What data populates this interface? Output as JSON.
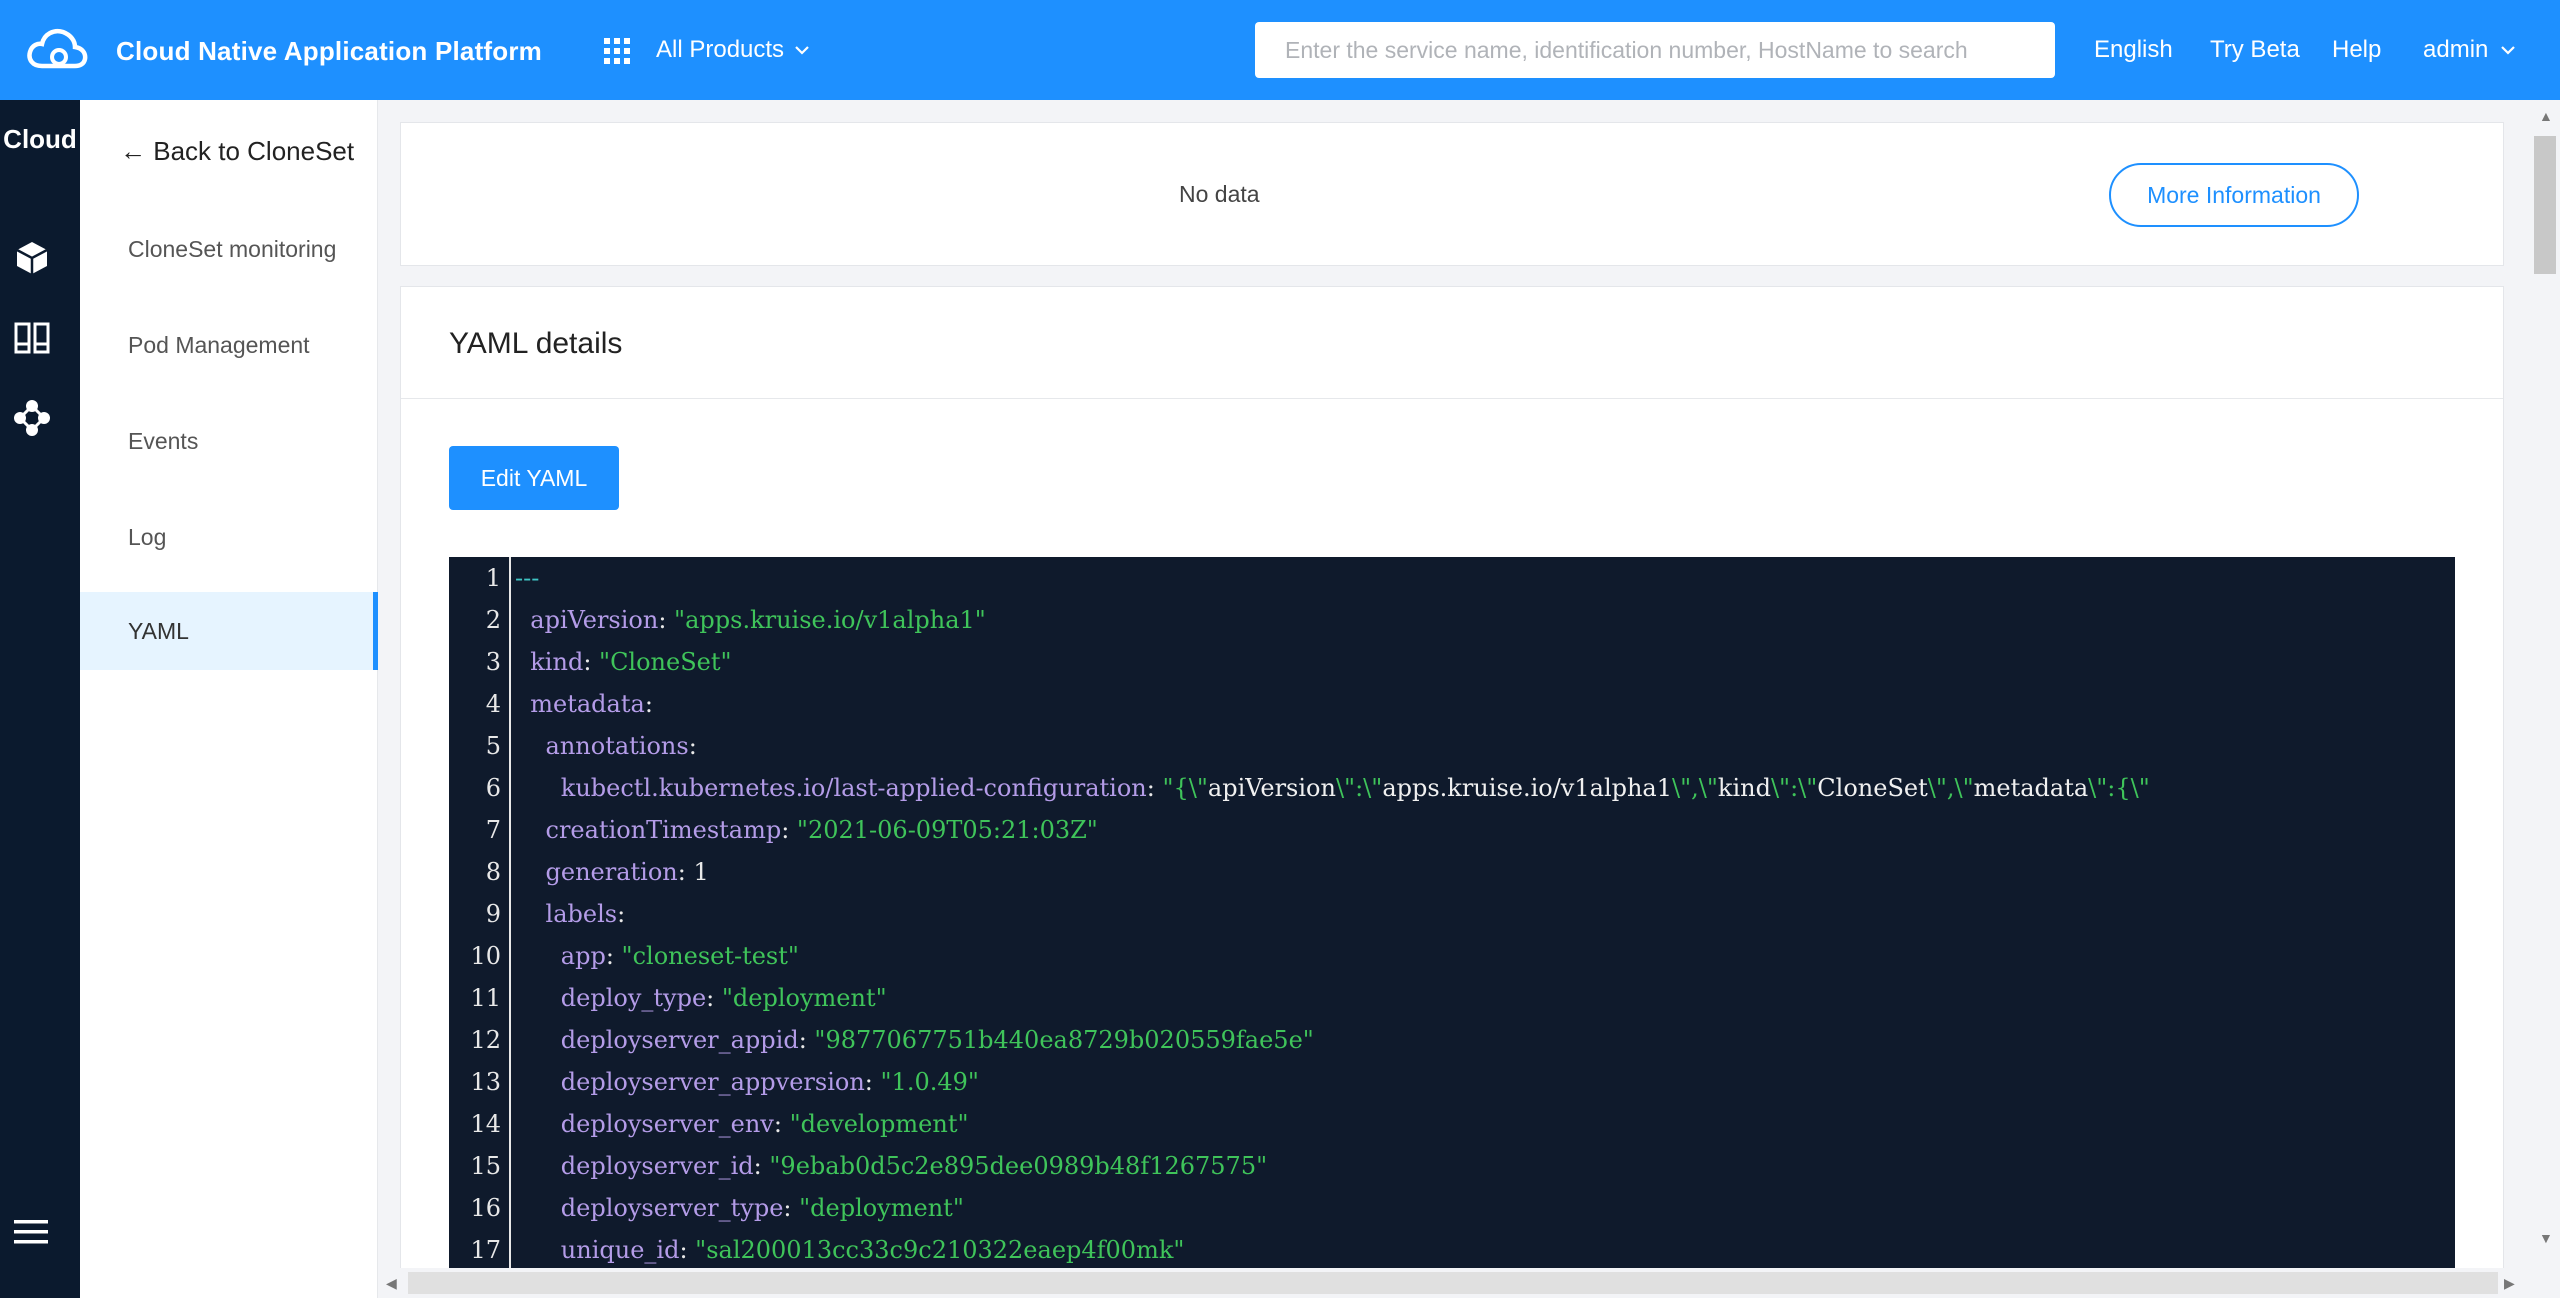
{
  "topbar": {
    "app_title": "Cloud Native Application Platform",
    "products_label": "All Products",
    "search_placeholder": "Enter the service name, identification number, HostName to search",
    "links": [
      "English",
      "Try Beta",
      "Help",
      "admin"
    ]
  },
  "rail": {
    "brand": "Cloud",
    "icons": [
      "cube-icon",
      "columns-icon",
      "nodes-icon",
      "menu-icon"
    ]
  },
  "subnav": {
    "back_label": "← Back to CloneSet",
    "items": [
      {
        "label": "CloneSet monitoring"
      },
      {
        "label": "Pod Management"
      },
      {
        "label": "Events"
      },
      {
        "label": "Log"
      },
      {
        "label": "YAML",
        "active": true
      }
    ]
  },
  "info_card": {
    "no_data": "No data",
    "more_button": "More Information"
  },
  "yaml_card": {
    "title": "YAML details",
    "edit_button": "Edit YAML",
    "lines": [
      {
        "n": "1",
        "indent": "",
        "key": "---",
        "sep": "",
        "val": "",
        "type": "dash"
      },
      {
        "n": "2",
        "indent": "  ",
        "key": "apiVersion",
        "sep": ": ",
        "val": "\"apps.kruise.io/v1alpha1\"",
        "type": "str"
      },
      {
        "n": "3",
        "indent": "  ",
        "key": "kind",
        "sep": ": ",
        "val": "\"CloneSet\"",
        "type": "str"
      },
      {
        "n": "4",
        "indent": "  ",
        "key": "metadata",
        "sep": ":",
        "val": "",
        "type": "none"
      },
      {
        "n": "5",
        "indent": "    ",
        "key": "annotations",
        "sep": ":",
        "val": "",
        "type": "none"
      },
      {
        "n": "6",
        "indent": "      ",
        "key": "kubectl.kubernetes.io/last-applied-configuration",
        "sep": ": ",
        "val": "",
        "type": "json"
      },
      {
        "n": "7",
        "indent": "    ",
        "key": "creationTimestamp",
        "sep": ": ",
        "val": "\"2021-06-09T05:21:03Z\"",
        "type": "str"
      },
      {
        "n": "8",
        "indent": "    ",
        "key": "generation",
        "sep": ": ",
        "val": "1",
        "type": "num"
      },
      {
        "n": "9",
        "indent": "    ",
        "key": "labels",
        "sep": ":",
        "val": "",
        "type": "none"
      },
      {
        "n": "10",
        "indent": "      ",
        "key": "app",
        "sep": ": ",
        "val": "\"cloneset-test\"",
        "type": "str"
      },
      {
        "n": "11",
        "indent": "      ",
        "key": "deploy_type",
        "sep": ": ",
        "val": "\"deployment\"",
        "type": "str"
      },
      {
        "n": "12",
        "indent": "      ",
        "key": "deployserver_appid",
        "sep": ": ",
        "val": "\"9877067751b440ea8729b020559fae5e\"",
        "type": "str"
      },
      {
        "n": "13",
        "indent": "      ",
        "key": "deployserver_appversion",
        "sep": ": ",
        "val": "\"1.0.49\"",
        "type": "str"
      },
      {
        "n": "14",
        "indent": "      ",
        "key": "deployserver_env",
        "sep": ": ",
        "val": "\"development\"",
        "type": "str"
      },
      {
        "n": "15",
        "indent": "      ",
        "key": "deployserver_id",
        "sep": ": ",
        "val": "\"9ebab0d5c2e895dee0989b48f1267575\"",
        "type": "str"
      },
      {
        "n": "16",
        "indent": "      ",
        "key": "deployserver_type",
        "sep": ": ",
        "val": "\"deployment\"",
        "type": "str"
      },
      {
        "n": "17",
        "indent": "      ",
        "key": "unique_id",
        "sep": ": ",
        "val": "\"sal200013cc33c9c210322eaep4f00mk\"",
        "type": "str"
      }
    ],
    "line6_json": [
      {
        "t": "\"{\\\"",
        "c": "s"
      },
      {
        "t": "apiVersion",
        "c": "w"
      },
      {
        "t": "\\\":\\\"",
        "c": "s"
      },
      {
        "t": "apps.kruise.io/v1alpha1",
        "c": "w"
      },
      {
        "t": "\\\",\\\"",
        "c": "s"
      },
      {
        "t": "kind",
        "c": "w"
      },
      {
        "t": "\\\":\\\"",
        "c": "s"
      },
      {
        "t": "CloneSet",
        "c": "w"
      },
      {
        "t": "\\\",\\\"",
        "c": "s"
      },
      {
        "t": "metadata",
        "c": "w"
      },
      {
        "t": "\\\":{\\\"",
        "c": "s"
      }
    ]
  },
  "colors": {
    "primary": "#1e90ff",
    "rail_bg": "#0b1a2e",
    "editor_bg": "#0f1a2c",
    "yaml_key": "#b49ce8",
    "yaml_string": "#3fc45a"
  }
}
